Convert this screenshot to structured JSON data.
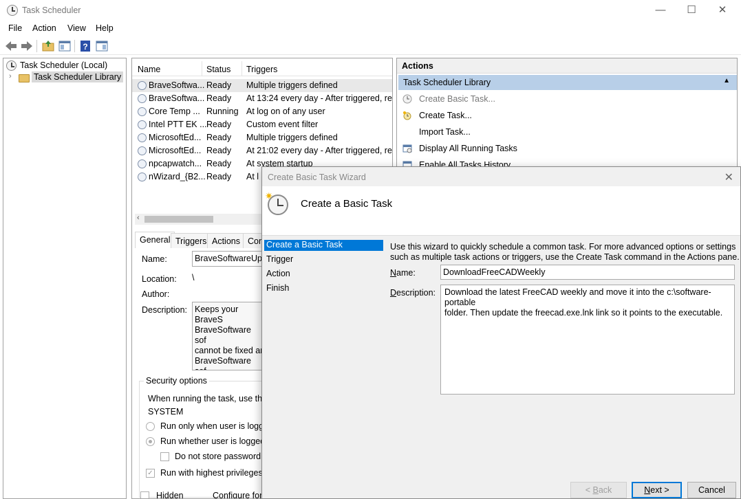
{
  "window": {
    "title": "Task Scheduler",
    "minimize": "—",
    "maximize": "☐",
    "close": "✕"
  },
  "menu": [
    "File",
    "Action",
    "View",
    "Help"
  ],
  "tree": {
    "root": "Task Scheduler (Local)",
    "library": "Task Scheduler Library"
  },
  "task_list": {
    "columns": [
      "Name",
      "Status",
      "Triggers"
    ],
    "rows": [
      {
        "name": "BraveSoftwa...",
        "status": "Ready",
        "trigger": "Multiple triggers defined"
      },
      {
        "name": "BraveSoftwa...",
        "status": "Ready",
        "trigger": "At 13:24 every day - After triggered, repe"
      },
      {
        "name": "Core Temp ...",
        "status": "Running",
        "trigger": "At log on of any user"
      },
      {
        "name": "Intel PTT EK ...",
        "status": "Ready",
        "trigger": "Custom event filter"
      },
      {
        "name": "MicrosoftEd...",
        "status": "Ready",
        "trigger": "Multiple triggers defined"
      },
      {
        "name": "MicrosoftEd...",
        "status": "Ready",
        "trigger": "At 21:02 every day - After triggered, repe"
      },
      {
        "name": "npcapwatch...",
        "status": "Ready",
        "trigger": "At system startup"
      },
      {
        "name": "nWizard_{B2...",
        "status": "Ready",
        "trigger": "At l"
      }
    ]
  },
  "detail": {
    "tabs": [
      "General",
      "Triggers",
      "Actions",
      "Con"
    ],
    "name_label": "Name:",
    "name_value": "BraveSoftwareUpd",
    "location_label": "Location:",
    "location_value": "\\",
    "author_label": "Author:",
    "description_label": "Description:",
    "description_lines": [
      "Keeps your BraveS",
      "BraveSoftware sof",
      "cannot be fixed ar",
      "BraveSoftware sof"
    ],
    "security_title": "Security options",
    "security_running": "When running the task, use the",
    "security_account": "SYSTEM",
    "radio_logged_on": "Run only when user is logge",
    "radio_logged_any": "Run whether user is logged",
    "chk_no_store": "Do not store password.",
    "chk_highest": "Run with highest privileges",
    "chk_hidden": "Hidden",
    "configure_for": "Configure for"
  },
  "actions_pane": {
    "header": "Actions",
    "section": "Task Scheduler Library",
    "items": [
      "Create Basic Task...",
      "Create Task...",
      "Import Task...",
      "Display All Running Tasks",
      "Enable All Tasks History"
    ]
  },
  "wizard": {
    "title": "Create Basic Task Wizard",
    "heading": "Create a Basic Task",
    "steps": [
      "Create a Basic Task",
      "Trigger",
      "Action",
      "Finish"
    ],
    "intro_lines": [
      "Use this wizard to quickly schedule a common task.  For more advanced options or settings",
      "such as multiple task actions or triggers, use the Create Task command in the Actions pane."
    ],
    "name_label_u": "N",
    "name_label_rest": "ame:",
    "name_value": "DownloadFreeCADWeekly",
    "desc_label_u": "D",
    "desc_label_rest": "escription:",
    "description_lines": [
      "Download the latest FreeCAD weekly and move it into the c:\\software-portable",
      "folder.   Then update the freecad.exe.lnk link so it points to the executable."
    ],
    "back_lt": "< ",
    "back_u": "B",
    "back_rest": "ack",
    "next_u": "N",
    "next_rest": "ext >",
    "cancel": "Cancel"
  }
}
